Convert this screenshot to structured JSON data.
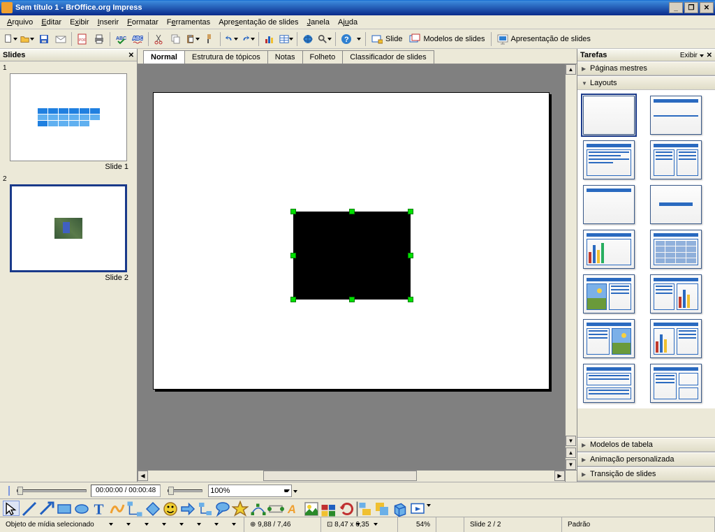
{
  "title": "Sem título 1 - BrOffice.org Impress",
  "menus": [
    "Arquivo",
    "Editar",
    "Exibir",
    "Inserir",
    "Formatar",
    "Ferramentas",
    "Apresentação de slides",
    "Janela",
    "Ajuda"
  ],
  "toolbar_labels": {
    "slide": "Slide",
    "modelos": "Modelos de slides",
    "apresentacao": "Apresentação de slides"
  },
  "slides_panel": {
    "title": "Slides"
  },
  "slides": [
    {
      "num": "1",
      "label": "Slide 1"
    },
    {
      "num": "2",
      "label": "Slide 2"
    }
  ],
  "view_tabs": [
    "Normal",
    "Estrutura de tópicos",
    "Notas",
    "Folheto",
    "Classificador de slides"
  ],
  "tasks_panel": {
    "title": "Tarefas",
    "view_label": "Exibir"
  },
  "task_sections": {
    "paginas": "Páginas mestres",
    "layouts": "Layouts",
    "modelos_tabela": "Modelos de tabela",
    "animacao": "Animação personalizada",
    "transicao": "Transição de slides"
  },
  "media": {
    "time": "00:00:00 / 00:00:48",
    "zoom": "100%"
  },
  "status": {
    "selection": "Objeto de mídia selecionado",
    "pos_icon": "⊕",
    "pos": "9,88 / 7,46",
    "size_icon": "⊡",
    "size": "8,47 x 6,35",
    "zoom": "54%",
    "slide": "Slide 2 / 2",
    "padrao": "Padrão"
  }
}
